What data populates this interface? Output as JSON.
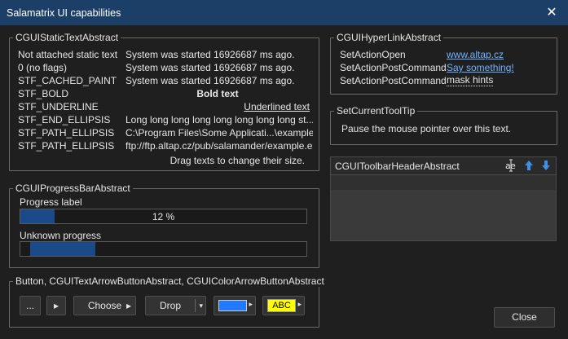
{
  "window": {
    "title": "Salamatrix UI capabilities"
  },
  "static_text": {
    "legend": "CGUIStaticTextAbstract",
    "rows": [
      {
        "label": "Not attached static text",
        "value": "System was started 16926687 ms ago."
      },
      {
        "label": "0 (no flags)",
        "value": "System was started 16926687 ms ago."
      },
      {
        "label": "STF_CACHED_PAINT",
        "value": "System was started 16926687 ms ago."
      },
      {
        "label": "STF_BOLD",
        "value": "Bold text"
      },
      {
        "label": "STF_UNDERLINE",
        "value": "Underlined text"
      },
      {
        "label": "STF_END_ELLIPSIS",
        "value": "Long long long long long long long long st..."
      },
      {
        "label": "STF_PATH_ELLIPSIS",
        "value": "C:\\Program Files\\Some Applicati...\\example.exe"
      },
      {
        "label": "STF_PATH_ELLIPSIS",
        "value": "ftp://ftp.altap.cz/pub/salamander/example.exe"
      }
    ],
    "hint": "Drag texts to change their size."
  },
  "progress": {
    "legend": "CGUIProgressBarAbstract",
    "label1": "Progress label",
    "value_text": "12 %",
    "value": 0.12,
    "label2": "Unknown progress"
  },
  "buttons": {
    "legend": "Button, CGUITextArrowButtonAbstract, CGUIColorArrowButtonAbstract",
    "dots": "...",
    "arrow": "▸",
    "choose": "Choose",
    "drop": "Drop",
    "color_value": "#1f7aff",
    "abc": "ABC",
    "abc_color": "#ffff00"
  },
  "hyperlink": {
    "legend": "CGUIHyperLinkAbstract",
    "rows": [
      {
        "label": "SetActionOpen",
        "value": "www.altap.cz"
      },
      {
        "label": "SetActionPostCommand",
        "value": "Say something!"
      },
      {
        "label": "SetActionPostCommand",
        "value": "mask hints"
      }
    ]
  },
  "tooltip": {
    "legend": "SetCurrentToolTip",
    "text": "Pause the mouse pointer over this text."
  },
  "toolbar": {
    "title": "CGUIToolbarHeaderAbstract",
    "icons": [
      "text-cursor-icon",
      "arrow-up-icon",
      "arrow-down-icon"
    ]
  },
  "footer": {
    "close": "Close"
  },
  "colors": {
    "titlebar": "#1c3f68",
    "link": "#6fb3ff",
    "progress": "#1a4a8a"
  }
}
